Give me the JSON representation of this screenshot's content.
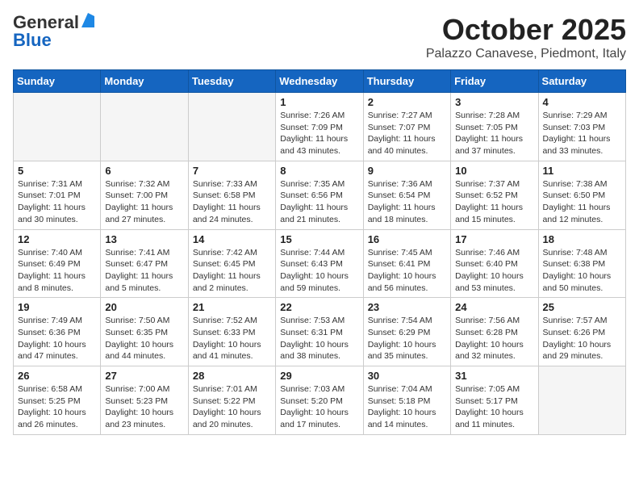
{
  "header": {
    "logo_general": "General",
    "logo_blue": "Blue",
    "month": "October 2025",
    "location": "Palazzo Canavese, Piedmont, Italy"
  },
  "days_of_week": [
    "Sunday",
    "Monday",
    "Tuesday",
    "Wednesday",
    "Thursday",
    "Friday",
    "Saturday"
  ],
  "weeks": [
    [
      {
        "day": "",
        "info": ""
      },
      {
        "day": "",
        "info": ""
      },
      {
        "day": "",
        "info": ""
      },
      {
        "day": "1",
        "info": "Sunrise: 7:26 AM\nSunset: 7:09 PM\nDaylight: 11 hours and 43 minutes."
      },
      {
        "day": "2",
        "info": "Sunrise: 7:27 AM\nSunset: 7:07 PM\nDaylight: 11 hours and 40 minutes."
      },
      {
        "day": "3",
        "info": "Sunrise: 7:28 AM\nSunset: 7:05 PM\nDaylight: 11 hours and 37 minutes."
      },
      {
        "day": "4",
        "info": "Sunrise: 7:29 AM\nSunset: 7:03 PM\nDaylight: 11 hours and 33 minutes."
      }
    ],
    [
      {
        "day": "5",
        "info": "Sunrise: 7:31 AM\nSunset: 7:01 PM\nDaylight: 11 hours and 30 minutes."
      },
      {
        "day": "6",
        "info": "Sunrise: 7:32 AM\nSunset: 7:00 PM\nDaylight: 11 hours and 27 minutes."
      },
      {
        "day": "7",
        "info": "Sunrise: 7:33 AM\nSunset: 6:58 PM\nDaylight: 11 hours and 24 minutes."
      },
      {
        "day": "8",
        "info": "Sunrise: 7:35 AM\nSunset: 6:56 PM\nDaylight: 11 hours and 21 minutes."
      },
      {
        "day": "9",
        "info": "Sunrise: 7:36 AM\nSunset: 6:54 PM\nDaylight: 11 hours and 18 minutes."
      },
      {
        "day": "10",
        "info": "Sunrise: 7:37 AM\nSunset: 6:52 PM\nDaylight: 11 hours and 15 minutes."
      },
      {
        "day": "11",
        "info": "Sunrise: 7:38 AM\nSunset: 6:50 PM\nDaylight: 11 hours and 12 minutes."
      }
    ],
    [
      {
        "day": "12",
        "info": "Sunrise: 7:40 AM\nSunset: 6:49 PM\nDaylight: 11 hours and 8 minutes."
      },
      {
        "day": "13",
        "info": "Sunrise: 7:41 AM\nSunset: 6:47 PM\nDaylight: 11 hours and 5 minutes."
      },
      {
        "day": "14",
        "info": "Sunrise: 7:42 AM\nSunset: 6:45 PM\nDaylight: 11 hours and 2 minutes."
      },
      {
        "day": "15",
        "info": "Sunrise: 7:44 AM\nSunset: 6:43 PM\nDaylight: 10 hours and 59 minutes."
      },
      {
        "day": "16",
        "info": "Sunrise: 7:45 AM\nSunset: 6:41 PM\nDaylight: 10 hours and 56 minutes."
      },
      {
        "day": "17",
        "info": "Sunrise: 7:46 AM\nSunset: 6:40 PM\nDaylight: 10 hours and 53 minutes."
      },
      {
        "day": "18",
        "info": "Sunrise: 7:48 AM\nSunset: 6:38 PM\nDaylight: 10 hours and 50 minutes."
      }
    ],
    [
      {
        "day": "19",
        "info": "Sunrise: 7:49 AM\nSunset: 6:36 PM\nDaylight: 10 hours and 47 minutes."
      },
      {
        "day": "20",
        "info": "Sunrise: 7:50 AM\nSunset: 6:35 PM\nDaylight: 10 hours and 44 minutes."
      },
      {
        "day": "21",
        "info": "Sunrise: 7:52 AM\nSunset: 6:33 PM\nDaylight: 10 hours and 41 minutes."
      },
      {
        "day": "22",
        "info": "Sunrise: 7:53 AM\nSunset: 6:31 PM\nDaylight: 10 hours and 38 minutes."
      },
      {
        "day": "23",
        "info": "Sunrise: 7:54 AM\nSunset: 6:29 PM\nDaylight: 10 hours and 35 minutes."
      },
      {
        "day": "24",
        "info": "Sunrise: 7:56 AM\nSunset: 6:28 PM\nDaylight: 10 hours and 32 minutes."
      },
      {
        "day": "25",
        "info": "Sunrise: 7:57 AM\nSunset: 6:26 PM\nDaylight: 10 hours and 29 minutes."
      }
    ],
    [
      {
        "day": "26",
        "info": "Sunrise: 6:58 AM\nSunset: 5:25 PM\nDaylight: 10 hours and 26 minutes."
      },
      {
        "day": "27",
        "info": "Sunrise: 7:00 AM\nSunset: 5:23 PM\nDaylight: 10 hours and 23 minutes."
      },
      {
        "day": "28",
        "info": "Sunrise: 7:01 AM\nSunset: 5:22 PM\nDaylight: 10 hours and 20 minutes."
      },
      {
        "day": "29",
        "info": "Sunrise: 7:03 AM\nSunset: 5:20 PM\nDaylight: 10 hours and 17 minutes."
      },
      {
        "day": "30",
        "info": "Sunrise: 7:04 AM\nSunset: 5:18 PM\nDaylight: 10 hours and 14 minutes."
      },
      {
        "day": "31",
        "info": "Sunrise: 7:05 AM\nSunset: 5:17 PM\nDaylight: 10 hours and 11 minutes."
      },
      {
        "day": "",
        "info": ""
      }
    ]
  ]
}
